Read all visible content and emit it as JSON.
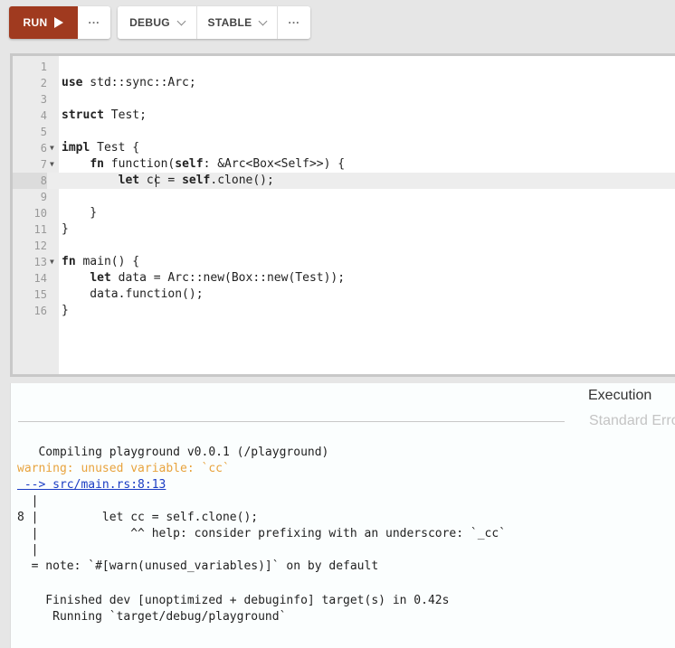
{
  "toolbar": {
    "run_label": "RUN",
    "run_more": "···",
    "channel_mode": "DEBUG",
    "channel": "STABLE",
    "config_more": "···"
  },
  "editor": {
    "cursor_line": 8,
    "lines": [
      "",
      "use std::sync::Arc;",
      "",
      "struct Test;",
      "",
      "impl Test {",
      "    fn function(self: &Arc<Box<Self>>) {",
      "        let cc = self.clone();",
      "",
      "    }",
      "}",
      "",
      "fn main() {",
      "    let data = Arc::new(Box::new(Test));",
      "    data.function();",
      "}"
    ]
  },
  "output": {
    "tab_execution": "Execution",
    "tab_stderr": "Standard Error",
    "lines": [
      "   Compiling playground v0.0.1 (/playground)",
      "warning: unused variable: `cc`",
      " --> src/main.rs:8:13",
      "  |",
      "8 |         let cc = self.clone();",
      "  |             ^^ help: consider prefixing with an underscore: `_cc`",
      "  |",
      "  = note: `#[warn(unused_variables)]` on by default",
      "",
      "    Finished dev [unoptimized + debuginfo] target(s) in 0.42s",
      "     Running `target/debug/playground`"
    ]
  }
}
